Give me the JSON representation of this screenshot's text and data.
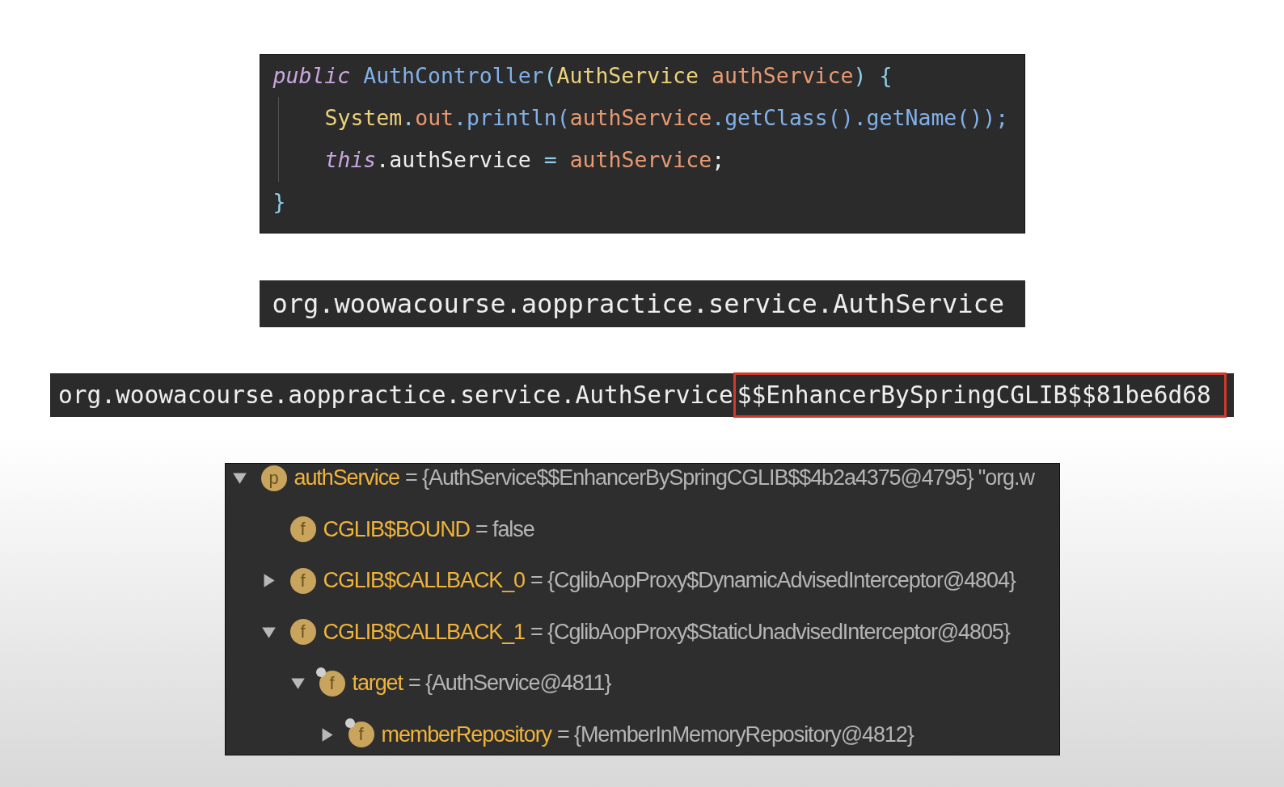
{
  "code_snippet": {
    "lines": [
      {
        "indented": false,
        "tokens": [
          {
            "text": "public ",
            "kind": "keyword"
          },
          {
            "text": "AuthController",
            "kind": "method"
          },
          {
            "text": "(",
            "kind": "punct"
          },
          {
            "text": "AuthService ",
            "kind": "class"
          },
          {
            "text": "authService",
            "kind": "param"
          },
          {
            "text": ") {",
            "kind": "punct"
          }
        ]
      },
      {
        "indented": true,
        "tokens": [
          {
            "text": "System",
            "kind": "class"
          },
          {
            "text": ".",
            "kind": "punct"
          },
          {
            "text": "out",
            "kind": "param"
          },
          {
            "text": ".println(",
            "kind": "method"
          },
          {
            "text": "authService",
            "kind": "param"
          },
          {
            "text": ".getClass().getName());",
            "kind": "method"
          }
        ]
      },
      {
        "indented": true,
        "tokens": [
          {
            "text": "this",
            "kind": "keyword"
          },
          {
            "text": ".authService",
            "kind": "plain"
          },
          {
            "text": " = ",
            "kind": "punct"
          },
          {
            "text": "authService",
            "kind": "param"
          },
          {
            "text": ";",
            "kind": "plain"
          }
        ]
      },
      {
        "indented": false,
        "tokens": [
          {
            "text": "}",
            "kind": "punct"
          }
        ]
      }
    ]
  },
  "output_plain": {
    "parts": [
      {
        "text": "org.woowacourse.aoppractice.service.AuthService",
        "kind": "plain"
      }
    ]
  },
  "output_proxy": {
    "parts": [
      {
        "text": "org.woowacourse.aoppractice.service.AuthService",
        "kind": "plain"
      },
      {
        "text": "$$EnhancerBySpringCGLIB$$81be6d68",
        "kind": "highlight"
      }
    ]
  },
  "debugger_tree": [
    {
      "kind": "node",
      "expanded": true,
      "badge": "p",
      "pinned": false,
      "name": "authService",
      "value": "= {AuthService$$EnhancerBySpringCGLIB$$4b2a4375@4795} \"org.w",
      "children": [
        {
          "kind": "leaf",
          "badge": "f",
          "pinned": false,
          "name": "CGLIB$BOUND",
          "value": "= false"
        },
        {
          "kind": "node",
          "expanded": false,
          "badge": "f",
          "pinned": false,
          "name": "CGLIB$CALLBACK_0",
          "value": "= {CglibAopProxy$DynamicAdvisedInterceptor@4804}"
        },
        {
          "kind": "node",
          "expanded": true,
          "badge": "f",
          "pinned": false,
          "name": "CGLIB$CALLBACK_1",
          "value": "= {CglibAopProxy$StaticUnadvisedInterceptor@4805}",
          "children": [
            {
              "kind": "node",
              "expanded": true,
              "badge": "f",
              "pinned": true,
              "name": "target",
              "value": "= {AuthService@4811}",
              "children": [
                {
                  "kind": "node",
                  "expanded": false,
                  "badge": "f",
                  "pinned": true,
                  "name": "memberRepository",
                  "value": "= {MemberInMemoryRepository@4812}"
                }
              ]
            }
          ]
        }
      ]
    }
  ]
}
